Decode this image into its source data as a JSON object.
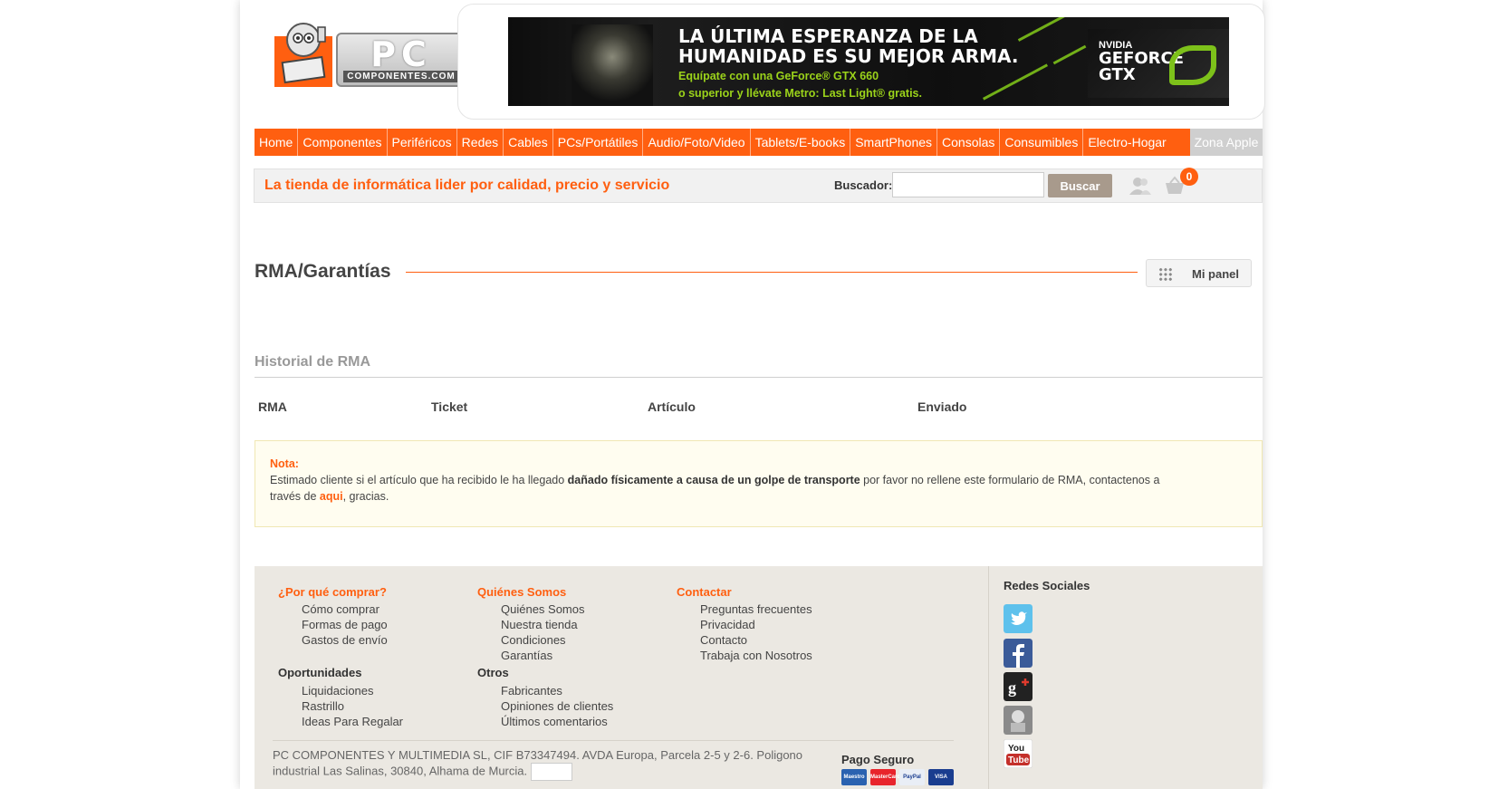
{
  "header": {
    "logo": {
      "pc": "PC",
      "sub": "COMPONENTES.COM"
    },
    "banner": {
      "title_line1": "LA ÚLTIMA ESPERANZA DE LA",
      "title_line2": "HUMANIDAD ES SU MEJOR ARMA.",
      "sub_line1": "Equípate con una GeForce® GTX 660",
      "sub_line2": "o superior y llévate Metro: Last Light® gratis.",
      "brand_small": "NVIDIA",
      "brand_big1": "GEFORCE",
      "brand_big2": "GTX"
    }
  },
  "nav": {
    "items": [
      {
        "label": "Home"
      },
      {
        "label": "Componentes"
      },
      {
        "label": "Periféricos"
      },
      {
        "label": "Redes"
      },
      {
        "label": "Cables"
      },
      {
        "label": "PCs/Portátiles"
      },
      {
        "label": "Audio/Foto/Video"
      },
      {
        "label": "Tablets/E-books"
      },
      {
        "label": "SmartPhones"
      },
      {
        "label": "Consolas"
      },
      {
        "label": "Consumibles"
      },
      {
        "label": "Electro-Hogar"
      }
    ],
    "apple": "Zona Apple"
  },
  "toolbar": {
    "tagline": "La tienda de informática lider por calidad, precio y servicio",
    "search_label": "Buscador:",
    "search_value": "",
    "search_button": "Buscar",
    "cart_count": "0"
  },
  "main": {
    "title": "RMA/Garantías",
    "panel_button": "Mi panel",
    "history_title": "Historial de RMA",
    "columns": [
      "RMA",
      "Ticket",
      "Artículo",
      "Enviado"
    ],
    "note": {
      "label": "Nota:",
      "text_before": "Estimado cliente si el artículo que ha recibido le ha llegado ",
      "text_bold": "dañado físicamente a causa de un golpe de transporte",
      "text_after": " por favor no rellene este formulario de RMA, contactenos a través de ",
      "link": "aqui",
      "text_end": ", gracias."
    }
  },
  "footer": {
    "col1": {
      "head1": "¿Por qué comprar?",
      "links1": [
        "Cómo comprar",
        "Formas de pago",
        "Gastos de envío"
      ],
      "head2": "Oportunidades",
      "links2": [
        "Liquidaciones",
        "Rastrillo",
        "Ideas Para Regalar"
      ]
    },
    "col2": {
      "head1": "Quiénes Somos",
      "links1": [
        "Quiénes Somos",
        "Nuestra tienda",
        "Condiciones",
        "Garantías"
      ],
      "head2": "Otros",
      "links2": [
        "Fabricantes",
        "Opiniones de clientes",
        "Últimos comentarios"
      ]
    },
    "col3": {
      "head1": "Contactar",
      "links1": [
        "Preguntas frecuentes",
        "Privacidad",
        "Contacto",
        "Trabaja con Nosotros"
      ]
    },
    "company_line1": "PC COMPONENTES Y MULTIMEDIA SL, CIF B73347494. AVDA Europa, Parcela 2-5 y 2-6. Poligono",
    "company_line2": "industrial Las Salinas, 30840, Alhama de Murcia.",
    "pago": "Pago Seguro",
    "cards": [
      "Maestro",
      "MasterCard",
      "PayPal",
      "VISA"
    ],
    "social_head": "Redes Sociales",
    "social": [
      {
        "icon": "twitter-icon",
        "color": "#5ec1ec"
      },
      {
        "icon": "facebook-icon",
        "color": "#3b5b99"
      },
      {
        "icon": "googleplus-icon",
        "color": "#222222"
      },
      {
        "icon": "mascot-icon",
        "color": "#8a8a8a"
      },
      {
        "icon": "youtube-icon",
        "color": "#c4302b"
      }
    ]
  }
}
